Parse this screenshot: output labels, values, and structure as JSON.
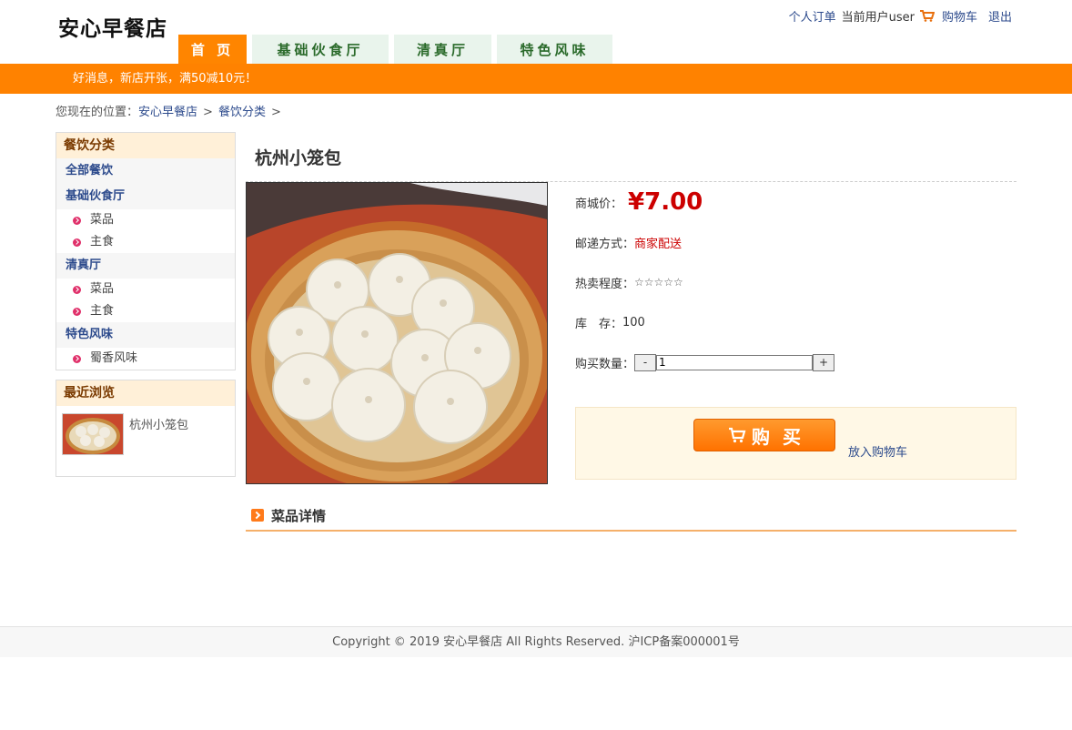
{
  "header": {
    "logo": "安心早餐店",
    "user_links": {
      "orders": "个人订单",
      "current_user": "当前用户user",
      "cart": "购物车",
      "logout": "退出"
    }
  },
  "nav": {
    "tabs": [
      {
        "label": "首 页"
      },
      {
        "label": "基础伙食厅"
      },
      {
        "label": "清真厅"
      },
      {
        "label": "特色风味"
      }
    ]
  },
  "banner": {
    "text": "好消息，新店开张，满50减10元！"
  },
  "breadcrumb": {
    "prefix": "您现在的位置：",
    "items": [
      "安心早餐店",
      "餐饮分类"
    ],
    "sep": ">"
  },
  "sidebar": {
    "categories_title": "餐饮分类",
    "all": "全部餐饮",
    "groups": [
      {
        "name": "基础伙食厅",
        "subs": [
          "菜品",
          "主食"
        ]
      },
      {
        "name": "清真厅",
        "subs": [
          "菜品",
          "主食"
        ]
      },
      {
        "name": "特色风味",
        "subs": [
          "蜀香风味"
        ]
      }
    ],
    "recent_title": "最近浏览",
    "recent_items": [
      {
        "name": "杭州小笼包"
      }
    ]
  },
  "product": {
    "title": "杭州小笼包",
    "price_label": "商城价：",
    "price": "¥7.00",
    "shipping_label": "邮递方式：",
    "shipping": "商家配送",
    "hot_label": "热卖程度：",
    "hot": "☆☆☆☆☆",
    "stock_label": "库　存：",
    "stock": "100",
    "qty_label": "购买数量：",
    "qty": "1",
    "minus": "-",
    "plus": "+",
    "buy": "购买",
    "add_cart": "放入购物车",
    "detail_title": "菜品详情"
  },
  "footer": {
    "text": "Copyright © 2019 安心早餐店 All Rights Reserved. 沪ICP备案000001号"
  },
  "colors": {
    "accent": "#ff8200",
    "price": "#cc0000",
    "link": "#2c4a8c"
  }
}
